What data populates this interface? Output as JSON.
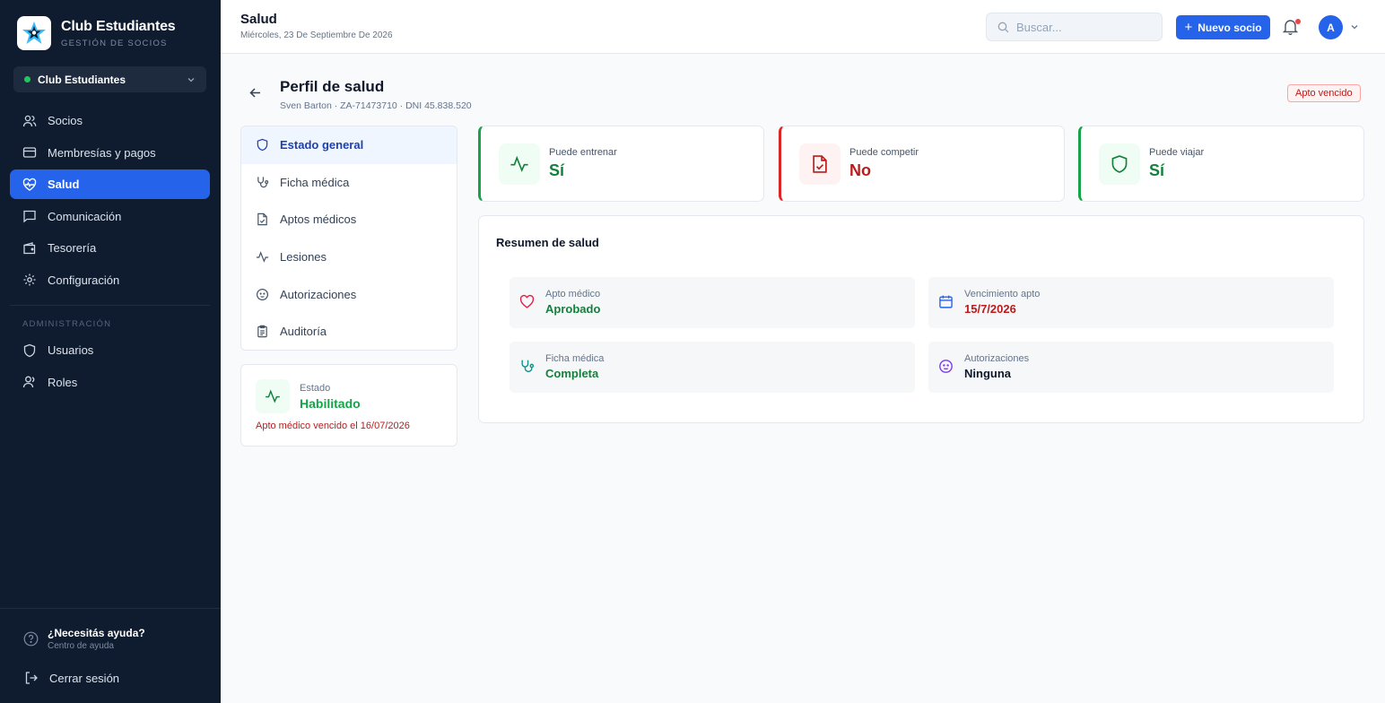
{
  "brand": {
    "name": "Club Estudiantes",
    "subtitle": "GESTIÓN DE SOCIOS"
  },
  "club_selector": {
    "value": "Club Estudiantes"
  },
  "nav": {
    "items": [
      {
        "label": "Socios",
        "icon": "users-icon"
      },
      {
        "label": "Membresías y pagos",
        "icon": "credit-card-icon"
      },
      {
        "label": "Salud",
        "icon": "heart-pulse-icon",
        "active": true
      },
      {
        "label": "Comunicación",
        "icon": "message-icon"
      },
      {
        "label": "Tesorería",
        "icon": "wallet-icon"
      },
      {
        "label": "Configuración",
        "icon": "gear-icon"
      }
    ],
    "admin_section": "ADMINISTRACIÓN",
    "admin_items": [
      {
        "label": "Usuarios",
        "icon": "shield-icon"
      },
      {
        "label": "Roles",
        "icon": "user-icon"
      }
    ]
  },
  "help": {
    "title": "¿Necesitás ayuda?",
    "subtitle": "Centro de ayuda"
  },
  "logout": {
    "label": "Cerrar sesión"
  },
  "header": {
    "title": "Salud",
    "date": "Miércoles, 23 De Septiembre De 2026",
    "search_placeholder": "Buscar...",
    "new_button": "Nuevo socio",
    "avatar_initial": "A"
  },
  "profile": {
    "title": "Perfil de salud",
    "subtitle": "Sven Barton · ZA-71473710 · DNI 45.838.520",
    "badge": "Apto vencido"
  },
  "tabs": [
    {
      "label": "Estado general",
      "icon": "shield-icon",
      "active": true
    },
    {
      "label": "Ficha médica",
      "icon": "stethoscope-icon"
    },
    {
      "label": "Aptos médicos",
      "icon": "file-check-icon"
    },
    {
      "label": "Lesiones",
      "icon": "activity-icon"
    },
    {
      "label": "Autorizaciones",
      "icon": "baby-icon"
    },
    {
      "label": "Auditoría",
      "icon": "clipboard-icon"
    }
  ],
  "status": {
    "label": "Estado",
    "value": "Habilitado",
    "note": "Apto médico vencido el 16/07/2026"
  },
  "kpis": [
    {
      "label": "Puede entrenar",
      "value": "Sí",
      "tone": "green",
      "icon": "activity-icon"
    },
    {
      "label": "Puede competir",
      "value": "No",
      "tone": "red",
      "icon": "file-check-icon"
    },
    {
      "label": "Puede viajar",
      "value": "Sí",
      "tone": "green",
      "icon": "shield-icon"
    }
  ],
  "summary": {
    "title": "Resumen de salud",
    "items": [
      {
        "label": "Apto médico",
        "value": "Aprobado",
        "value_color": "#15803d",
        "icon": "heart-icon"
      },
      {
        "label": "Vencimiento apto",
        "value": "15/7/2026",
        "value_color": "#b91c1c",
        "icon": "calendar-icon"
      },
      {
        "label": "Ficha médica",
        "value": "Completa",
        "value_color": "#15803d",
        "icon": "stethoscope-icon"
      },
      {
        "label": "Autorizaciones",
        "value": "Ninguna",
        "value_color": "#0f172a",
        "icon": "baby-icon"
      }
    ]
  },
  "colors": {
    "accent": "#2563eb",
    "sidebar": "#0f1c30",
    "success": "#16a34a",
    "danger": "#dc2626"
  }
}
